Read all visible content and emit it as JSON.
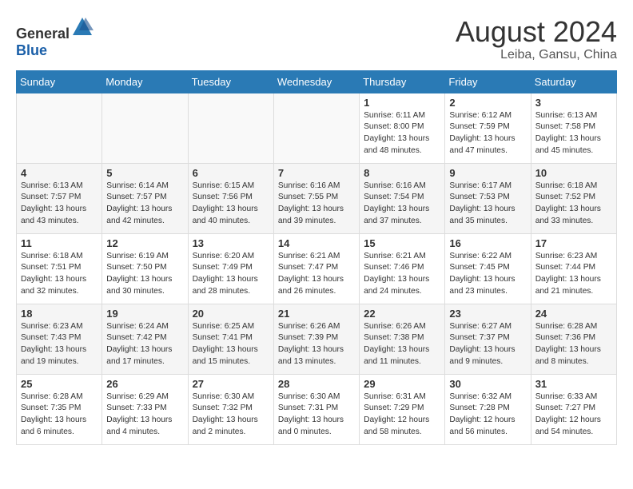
{
  "logo": {
    "text_general": "General",
    "text_blue": "Blue"
  },
  "title": {
    "month_year": "August 2024",
    "location": "Leiba, Gansu, China"
  },
  "days_of_week": [
    "Sunday",
    "Monday",
    "Tuesday",
    "Wednesday",
    "Thursday",
    "Friday",
    "Saturday"
  ],
  "weeks": [
    {
      "days": [
        {
          "num": "",
          "info": ""
        },
        {
          "num": "",
          "info": ""
        },
        {
          "num": "",
          "info": ""
        },
        {
          "num": "",
          "info": ""
        },
        {
          "num": "1",
          "info": "Sunrise: 6:11 AM\nSunset: 8:00 PM\nDaylight: 13 hours\nand 48 minutes."
        },
        {
          "num": "2",
          "info": "Sunrise: 6:12 AM\nSunset: 7:59 PM\nDaylight: 13 hours\nand 47 minutes."
        },
        {
          "num": "3",
          "info": "Sunrise: 6:13 AM\nSunset: 7:58 PM\nDaylight: 13 hours\nand 45 minutes."
        }
      ]
    },
    {
      "days": [
        {
          "num": "4",
          "info": "Sunrise: 6:13 AM\nSunset: 7:57 PM\nDaylight: 13 hours\nand 43 minutes."
        },
        {
          "num": "5",
          "info": "Sunrise: 6:14 AM\nSunset: 7:57 PM\nDaylight: 13 hours\nand 42 minutes."
        },
        {
          "num": "6",
          "info": "Sunrise: 6:15 AM\nSunset: 7:56 PM\nDaylight: 13 hours\nand 40 minutes."
        },
        {
          "num": "7",
          "info": "Sunrise: 6:16 AM\nSunset: 7:55 PM\nDaylight: 13 hours\nand 39 minutes."
        },
        {
          "num": "8",
          "info": "Sunrise: 6:16 AM\nSunset: 7:54 PM\nDaylight: 13 hours\nand 37 minutes."
        },
        {
          "num": "9",
          "info": "Sunrise: 6:17 AM\nSunset: 7:53 PM\nDaylight: 13 hours\nand 35 minutes."
        },
        {
          "num": "10",
          "info": "Sunrise: 6:18 AM\nSunset: 7:52 PM\nDaylight: 13 hours\nand 33 minutes."
        }
      ]
    },
    {
      "days": [
        {
          "num": "11",
          "info": "Sunrise: 6:18 AM\nSunset: 7:51 PM\nDaylight: 13 hours\nand 32 minutes."
        },
        {
          "num": "12",
          "info": "Sunrise: 6:19 AM\nSunset: 7:50 PM\nDaylight: 13 hours\nand 30 minutes."
        },
        {
          "num": "13",
          "info": "Sunrise: 6:20 AM\nSunset: 7:49 PM\nDaylight: 13 hours\nand 28 minutes."
        },
        {
          "num": "14",
          "info": "Sunrise: 6:21 AM\nSunset: 7:47 PM\nDaylight: 13 hours\nand 26 minutes."
        },
        {
          "num": "15",
          "info": "Sunrise: 6:21 AM\nSunset: 7:46 PM\nDaylight: 13 hours\nand 24 minutes."
        },
        {
          "num": "16",
          "info": "Sunrise: 6:22 AM\nSunset: 7:45 PM\nDaylight: 13 hours\nand 23 minutes."
        },
        {
          "num": "17",
          "info": "Sunrise: 6:23 AM\nSunset: 7:44 PM\nDaylight: 13 hours\nand 21 minutes."
        }
      ]
    },
    {
      "days": [
        {
          "num": "18",
          "info": "Sunrise: 6:23 AM\nSunset: 7:43 PM\nDaylight: 13 hours\nand 19 minutes."
        },
        {
          "num": "19",
          "info": "Sunrise: 6:24 AM\nSunset: 7:42 PM\nDaylight: 13 hours\nand 17 minutes."
        },
        {
          "num": "20",
          "info": "Sunrise: 6:25 AM\nSunset: 7:41 PM\nDaylight: 13 hours\nand 15 minutes."
        },
        {
          "num": "21",
          "info": "Sunrise: 6:26 AM\nSunset: 7:39 PM\nDaylight: 13 hours\nand 13 minutes."
        },
        {
          "num": "22",
          "info": "Sunrise: 6:26 AM\nSunset: 7:38 PM\nDaylight: 13 hours\nand 11 minutes."
        },
        {
          "num": "23",
          "info": "Sunrise: 6:27 AM\nSunset: 7:37 PM\nDaylight: 13 hours\nand 9 minutes."
        },
        {
          "num": "24",
          "info": "Sunrise: 6:28 AM\nSunset: 7:36 PM\nDaylight: 13 hours\nand 8 minutes."
        }
      ]
    },
    {
      "days": [
        {
          "num": "25",
          "info": "Sunrise: 6:28 AM\nSunset: 7:35 PM\nDaylight: 13 hours\nand 6 minutes."
        },
        {
          "num": "26",
          "info": "Sunrise: 6:29 AM\nSunset: 7:33 PM\nDaylight: 13 hours\nand 4 minutes."
        },
        {
          "num": "27",
          "info": "Sunrise: 6:30 AM\nSunset: 7:32 PM\nDaylight: 13 hours\nand 2 minutes."
        },
        {
          "num": "28",
          "info": "Sunrise: 6:30 AM\nSunset: 7:31 PM\nDaylight: 13 hours\nand 0 minutes."
        },
        {
          "num": "29",
          "info": "Sunrise: 6:31 AM\nSunset: 7:29 PM\nDaylight: 12 hours\nand 58 minutes."
        },
        {
          "num": "30",
          "info": "Sunrise: 6:32 AM\nSunset: 7:28 PM\nDaylight: 12 hours\nand 56 minutes."
        },
        {
          "num": "31",
          "info": "Sunrise: 6:33 AM\nSunset: 7:27 PM\nDaylight: 12 hours\nand 54 minutes."
        }
      ]
    }
  ]
}
